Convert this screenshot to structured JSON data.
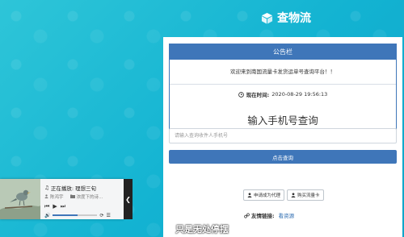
{
  "brand": {
    "name": "查物流",
    "icon": "box-icon"
  },
  "notice": {
    "header": "公告栏",
    "message": "欢迎来到南国流量卡发货运单号查询平台！！",
    "time_label": "现在时间:",
    "time_value": "2020-08-29 19:56:13"
  },
  "query": {
    "title": "输入手机号查询",
    "placeholder": "请输入查询收件人手机号",
    "button": "点击查询"
  },
  "links": {
    "agent_button": "申请成为代理",
    "buy_button": "购买流量卡",
    "friend_label": "友情链接:",
    "friend_link": "看资源"
  },
  "subtitle": "只是无处停摆",
  "player": {
    "status_label": "正在播放:",
    "song": "理想三旬",
    "artist": "陈鸿宇",
    "album": "浓度下的诗…",
    "volume": 0.55
  },
  "colors": {
    "accent": "#3f76b9",
    "background": "#13b3d2"
  }
}
